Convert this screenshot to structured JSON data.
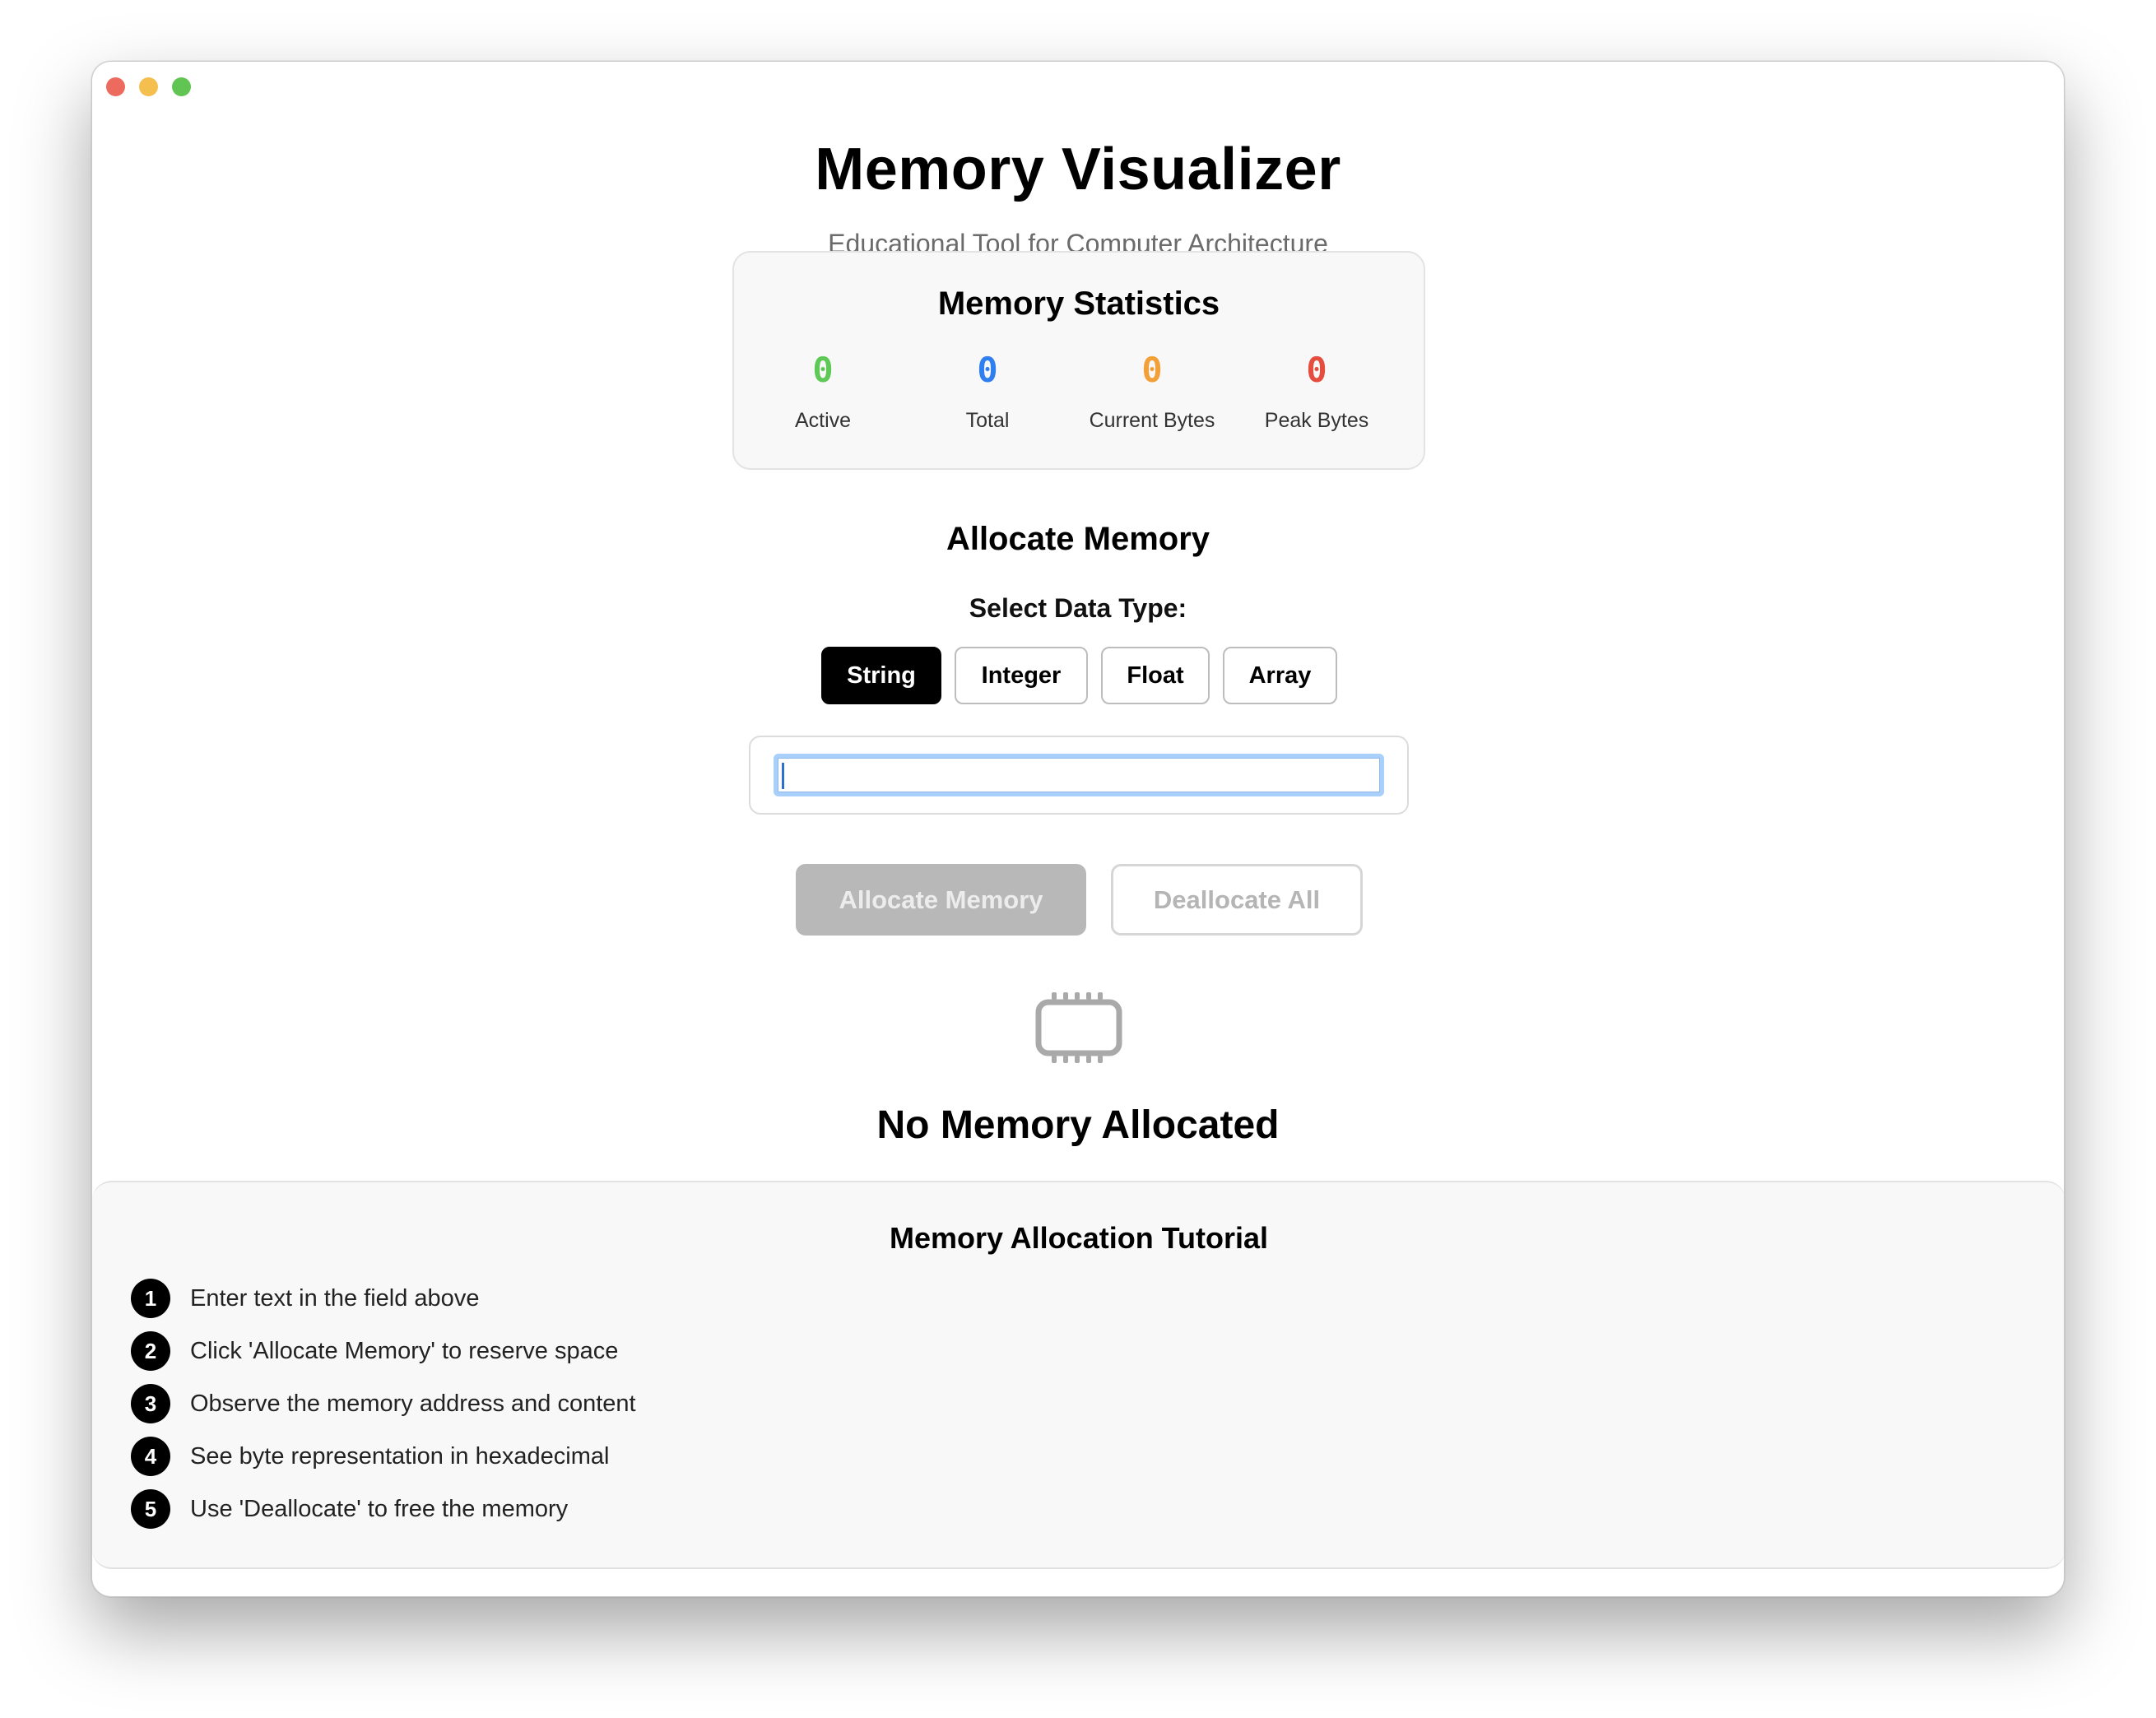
{
  "app": {
    "title": "Memory Visualizer",
    "subtitle": "Educational Tool for Computer Architecture"
  },
  "stats": {
    "title": "Memory Statistics",
    "items": [
      {
        "value": "0",
        "label": "Active",
        "color": "#5fc957"
      },
      {
        "value": "0",
        "label": "Total",
        "color": "#2f7ff0"
      },
      {
        "value": "0",
        "label": "Current Bytes",
        "color": "#f2a13a"
      },
      {
        "value": "0",
        "label": "Peak Bytes",
        "color": "#e54d3f"
      }
    ]
  },
  "allocate": {
    "title": "Allocate Memory",
    "select_label": "Select Data Type:",
    "types": [
      "String",
      "Integer",
      "Float",
      "Array"
    ],
    "selected_type": "String",
    "input_value": "",
    "allocate_button": "Allocate Memory",
    "deallocate_button": "Deallocate All"
  },
  "empty_state": {
    "icon": "memory-chip-icon",
    "title": "No Memory Allocated"
  },
  "tutorial": {
    "title": "Memory Allocation Tutorial",
    "steps": [
      {
        "num": "1",
        "text": "Enter text in the field above"
      },
      {
        "num": "2",
        "text": "Click 'Allocate Memory' to reserve space"
      },
      {
        "num": "3",
        "text": "Observe the memory address and content"
      },
      {
        "num": "4",
        "text": "See byte representation in hexadecimal"
      },
      {
        "num": "5",
        "text": "Use 'Deallocate' to free the memory"
      }
    ]
  }
}
